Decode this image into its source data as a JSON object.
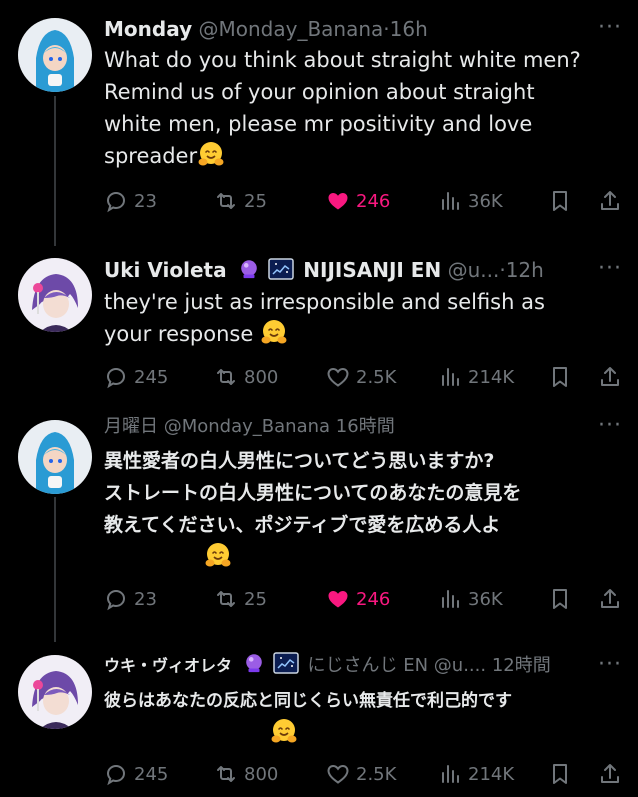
{
  "tweets": [
    {
      "name": "Monday",
      "handle": "@Monday_Banana",
      "time": "16h",
      "lines": [
        "What do you think about straight white men?",
        "Remind us of your opinion about straight",
        "white men, please mr positivity and love",
        "spreader"
      ],
      "replies": "23",
      "retweets": "25",
      "likes": "246",
      "views": "36K"
    },
    {
      "name": "Uki Violeta",
      "org": "NIJISANJI EN",
      "handle": "@u...",
      "time": "12h",
      "lines": [
        "they're just as irresponsible and selfish as",
        "your response"
      ],
      "replies": "245",
      "retweets": "800",
      "likes": "2.5K",
      "views": "214K"
    },
    {
      "name": "月曜日",
      "handle": "@Monday_Banana",
      "time": "16時間",
      "lines": [
        "異性愛者の白人男性についてどう思いますか?",
        "ストレートの白人男性についてのあなたの意見を",
        "教えてください、ポジティブで愛を広める人よ"
      ],
      "replies": "23",
      "retweets": "25",
      "likes": "246",
      "views": "36K"
    },
    {
      "name": "ウキ・ヴィオレタ",
      "org": "にじさんじ EN",
      "handle": "@u....",
      "time": "12時間",
      "lines": [
        "彼らはあなたの反応と同じくらい無責任で利己的です"
      ],
      "replies": "245",
      "retweets": "800",
      "likes": "2.5K",
      "views": "214K"
    }
  ],
  "icons": [
    "reply-icon",
    "retweet-icon",
    "heart-icon",
    "views-icon",
    "bookmark-icon",
    "share-icon"
  ],
  "colors": {
    "like": "#f91880",
    "muted": "#71767b",
    "text": "#e7e9ea"
  }
}
